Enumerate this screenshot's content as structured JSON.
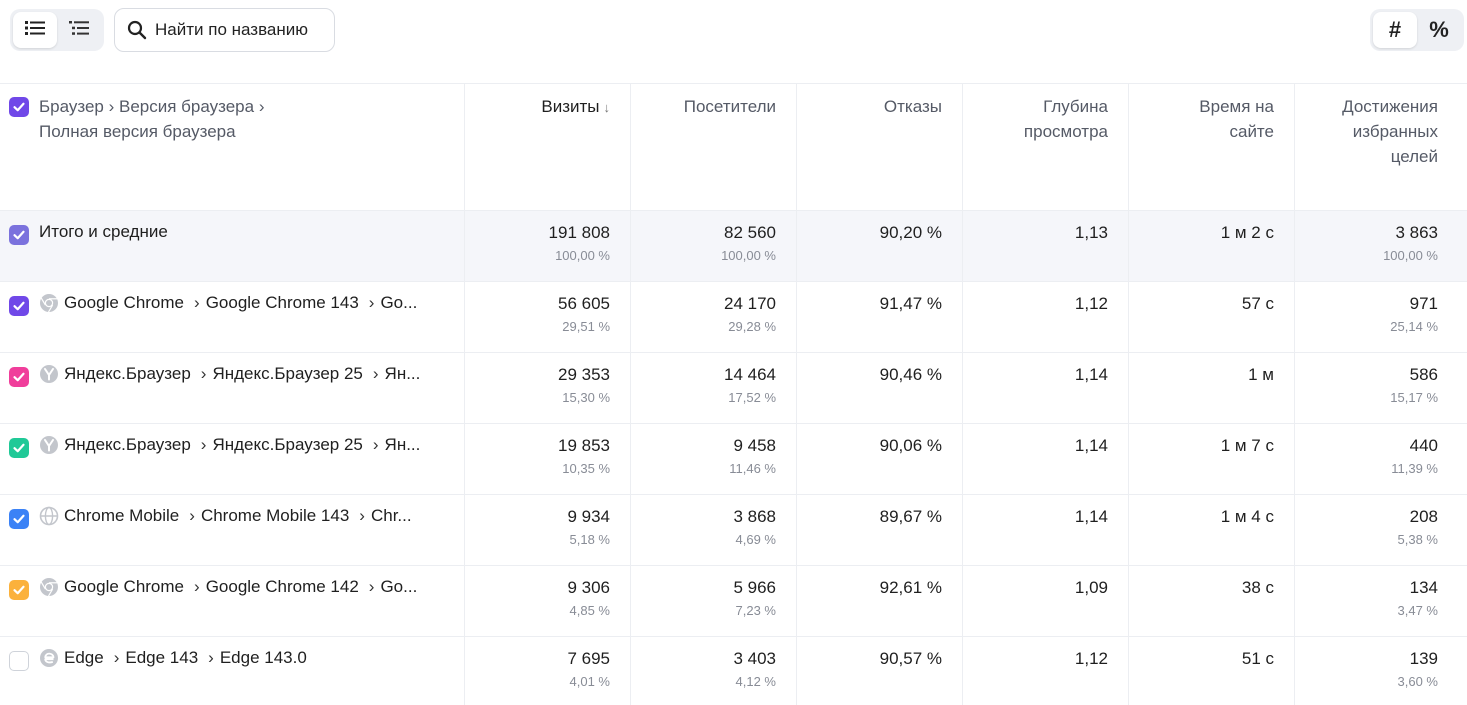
{
  "toolbar": {
    "search_placeholder": "Найти по названию",
    "unit_absolute": "#",
    "unit_percent": "%"
  },
  "colors": {
    "purple": "#7048e8",
    "lavender": "#7b72dd",
    "pink": "#f03e9b",
    "green": "#20c997",
    "blue": "#3b82f6",
    "orange": "#fbb13c"
  },
  "table": {
    "dimension_title": "Браузер › Версия браузера › Полная версия браузера",
    "columns": [
      "Визиты",
      "Посетители",
      "Отказы",
      "Глубина просмотра",
      "Время на сайте",
      "Достижения избранных целей"
    ],
    "sort_indicator": "↓",
    "total": {
      "name": "Итого и средние",
      "visits": "191 808",
      "visits_pct": "100,00 %",
      "visitors": "82 560",
      "visitors_pct": "100,00 %",
      "bounce": "90,20 %",
      "depth": "1,13",
      "time": "1 м 2 с",
      "goals": "3 863",
      "goals_pct": "100,00 %"
    },
    "rows": [
      {
        "icon": "chrome-icon",
        "checkbox": "purple",
        "name": "Google Chrome",
        "version": "Google Chrome 143",
        "full": "Go...",
        "visits": "56 605",
        "visits_pct": "29,51 %",
        "visitors": "24 170",
        "visitors_pct": "29,28 %",
        "bounce": "91,47 %",
        "depth": "1,12",
        "time": "57 с",
        "goals": "971",
        "goals_pct": "25,14 %"
      },
      {
        "icon": "yandex-browser-icon",
        "checkbox": "pink",
        "name": "Яндекс.Браузер",
        "version": "Яндекс.Браузер 25",
        "full": "Ян...",
        "visits": "29 353",
        "visits_pct": "15,30 %",
        "visitors": "14 464",
        "visitors_pct": "17,52 %",
        "bounce": "90,46 %",
        "depth": "1,14",
        "time": "1 м",
        "goals": "586",
        "goals_pct": "15,17 %"
      },
      {
        "icon": "yandex-browser-icon",
        "checkbox": "green",
        "name": "Яндекс.Браузер",
        "version": "Яндекс.Браузер 25",
        "full": "Ян...",
        "visits": "19 853",
        "visits_pct": "10,35 %",
        "visitors": "9 458",
        "visitors_pct": "11,46 %",
        "bounce": "90,06 %",
        "depth": "1,14",
        "time": "1 м 7 с",
        "goals": "440",
        "goals_pct": "11,39 %"
      },
      {
        "icon": "globe-icon",
        "checkbox": "blue",
        "name": "Chrome Mobile",
        "version": "Chrome Mobile 143",
        "full": "Chr...",
        "visits": "9 934",
        "visits_pct": "5,18 %",
        "visitors": "3 868",
        "visitors_pct": "4,69 %",
        "bounce": "89,67 %",
        "depth": "1,14",
        "time": "1 м 4 с",
        "goals": "208",
        "goals_pct": "5,38 %"
      },
      {
        "icon": "chrome-icon",
        "checkbox": "orange",
        "name": "Google Chrome",
        "version": "Google Chrome 142",
        "full": "Go...",
        "visits": "9 306",
        "visits_pct": "4,85 %",
        "visitors": "5 966",
        "visitors_pct": "7,23 %",
        "bounce": "92,61 %",
        "depth": "1,09",
        "time": "38 с",
        "goals": "134",
        "goals_pct": "3,47 %"
      },
      {
        "icon": "edge-icon",
        "checkbox": "none",
        "name": "Edge",
        "version": "Edge 143",
        "full": "Edge 143.0",
        "visits": "7 695",
        "visits_pct": "4,01 %",
        "visitors": "3 403",
        "visitors_pct": "4,12 %",
        "bounce": "90,57 %",
        "depth": "1,12",
        "time": "51 с",
        "goals": "139",
        "goals_pct": "3,60 %"
      }
    ]
  }
}
